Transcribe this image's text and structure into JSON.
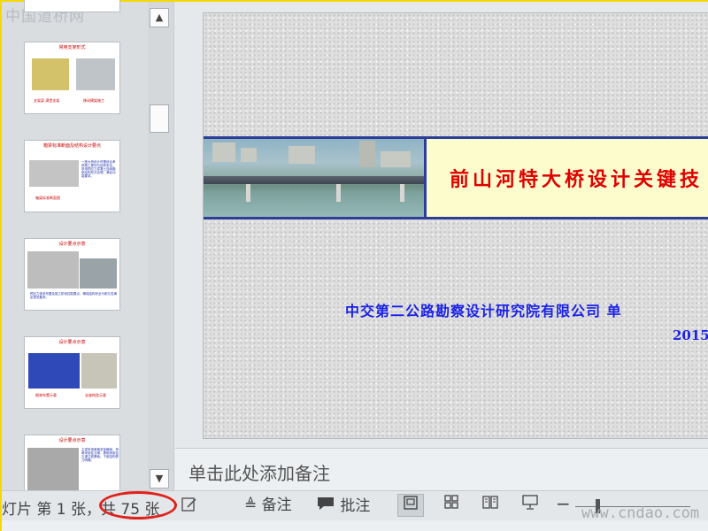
{
  "watermarks": {
    "top_left": "中国道桥网",
    "bottom_right": "www.cndao.com"
  },
  "thumbnails": [
    {
      "title": "常用支架形式",
      "captions": [
        "支架梁 满堂支架",
        "移动模架施工"
      ]
    },
    {
      "title": "箱梁标准断面及结构设计要点",
      "text": "一座大桥设计时需综合考虑施工便利与结构安全，采用预应力混凝土连续箱梁结构形式合理，满足功能要求。",
      "captions": [
        "箱梁标准断面图"
      ]
    },
    {
      "title": "设计要点示意",
      "text": "预应力体系布置及施工阶段控制要点，确保结构安全与耐久性满足规范要求。"
    },
    {
      "title": "设计要点示意",
      "captions": [
        "钢束布置示意",
        "支座构造示意"
      ]
    },
    {
      "title": "设计要点示意",
      "text": "主梁采用单箱多室截面，桥墩采用柱式墩，基础采用钻孔灌注桩基础，下部结构受力明确。"
    }
  ],
  "slide": {
    "title": "前山河特大桥设计关键技",
    "company": "中交第二公路勘察设计研究院有限公司  单",
    "date": "2015-"
  },
  "notes": {
    "placeholder": "单击此处添加备注"
  },
  "status_bar": {
    "slide_count": "灯片 第 1 张，共 75 张",
    "notes_label": "备注",
    "comments_label": "批注",
    "zoom_minus": "−"
  },
  "colors": {
    "title_red": "#e00000",
    "company_blue": "#1b22e8",
    "banner_blue": "#2c3e98",
    "highlight_ring": "#e0221c"
  }
}
